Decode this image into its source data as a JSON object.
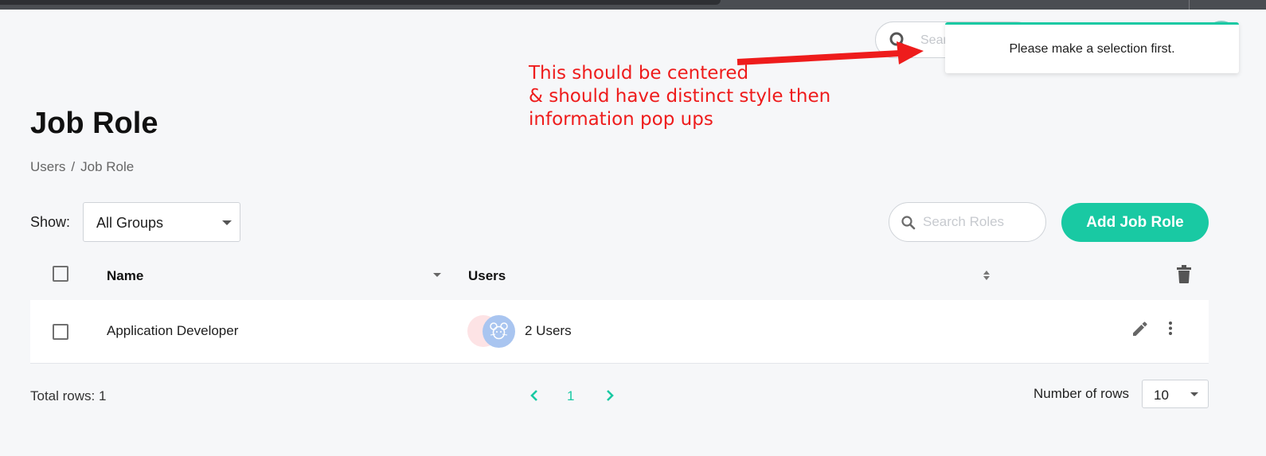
{
  "header": {
    "search_placeholder": "Sear"
  },
  "toast": {
    "message": "Please make a selection first.",
    "accent_color": "#19c9a3"
  },
  "annotation": {
    "lines": [
      "This should be centered",
      "& should have distinct style then",
      "information pop ups"
    ],
    "color": "#ee1c1c"
  },
  "page": {
    "title": "Job Role",
    "breadcrumb": [
      "Users",
      "/",
      "Job Role"
    ]
  },
  "toolbar": {
    "show_label": "Show:",
    "group_select_value": "All Groups",
    "search_placeholder": "Search Roles",
    "add_button_label": "Add Job Role"
  },
  "table": {
    "columns": [
      "Name",
      "Users"
    ],
    "rows": [
      {
        "name": "Application Developer",
        "users": "2 Users"
      }
    ]
  },
  "footer": {
    "total_rows": "Total rows: 1",
    "current_page": "1",
    "rows_label": "Number of rows",
    "rows_value": "10"
  },
  "icons": [
    "search-icon",
    "trash-icon",
    "pencil-icon",
    "more-vertical-icon",
    "chevron-left-icon",
    "chevron-right-icon",
    "mouse-avatar-icon"
  ],
  "colors": {
    "accent": "#19c9a3",
    "background": "#f6f7f9"
  }
}
